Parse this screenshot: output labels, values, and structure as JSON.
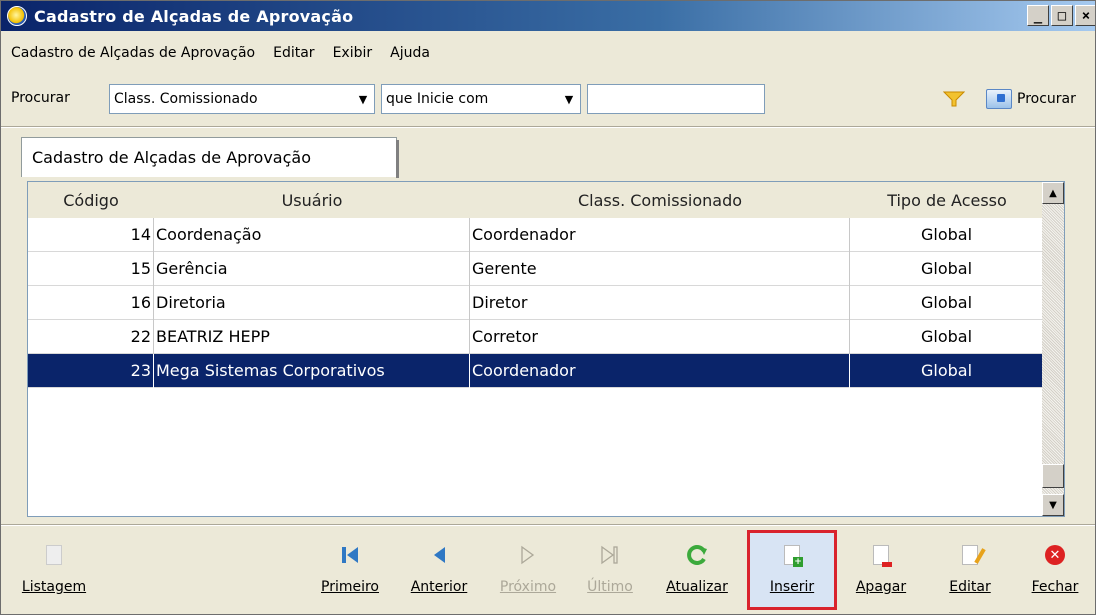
{
  "window": {
    "title": "Cadastro de Alçadas de Aprovação"
  },
  "menu": [
    "Cadastro de Alçadas de Aprovação",
    "Editar",
    "Exibir",
    "Ajuda"
  ],
  "search": {
    "label": "Procurar",
    "field_value": "Class. Comissionado",
    "condition_value": "que Inicie com",
    "input_value": "",
    "find_label": "Procurar"
  },
  "tab": {
    "label": "Cadastro de Alçadas de Aprovação"
  },
  "grid": {
    "columns": [
      "Código",
      "Usuário",
      "Class. Comissionado",
      "Tipo de Acesso"
    ],
    "rows": [
      {
        "code": "14",
        "user": "Coordenação",
        "class": "Coordenador",
        "type": "Global"
      },
      {
        "code": "15",
        "user": "Gerência",
        "class": "Gerente",
        "type": "Global"
      },
      {
        "code": "16",
        "user": "Diretoria",
        "class": "Diretor",
        "type": "Global"
      },
      {
        "code": "22",
        "user": "BEATRIZ HEPP",
        "class": "Corretor",
        "type": "Global"
      },
      {
        "code": "23",
        "user": "Mega Sistemas Corporativos",
        "class": "Coordenador",
        "type": "Global"
      }
    ]
  },
  "toolbar": {
    "listagem": "Listagem",
    "primeiro": "Primeiro",
    "anterior": "Anterior",
    "proximo": "Próximo",
    "ultimo": "Último",
    "atualizar": "Atualizar",
    "inserir": "Inserir",
    "apagar": "Apagar",
    "editar": "Editar",
    "fechar": "Fechar"
  },
  "colors": {
    "selection": "#0a246a",
    "highlight_border": "#d9232d",
    "title_bar": "#0a246a"
  }
}
